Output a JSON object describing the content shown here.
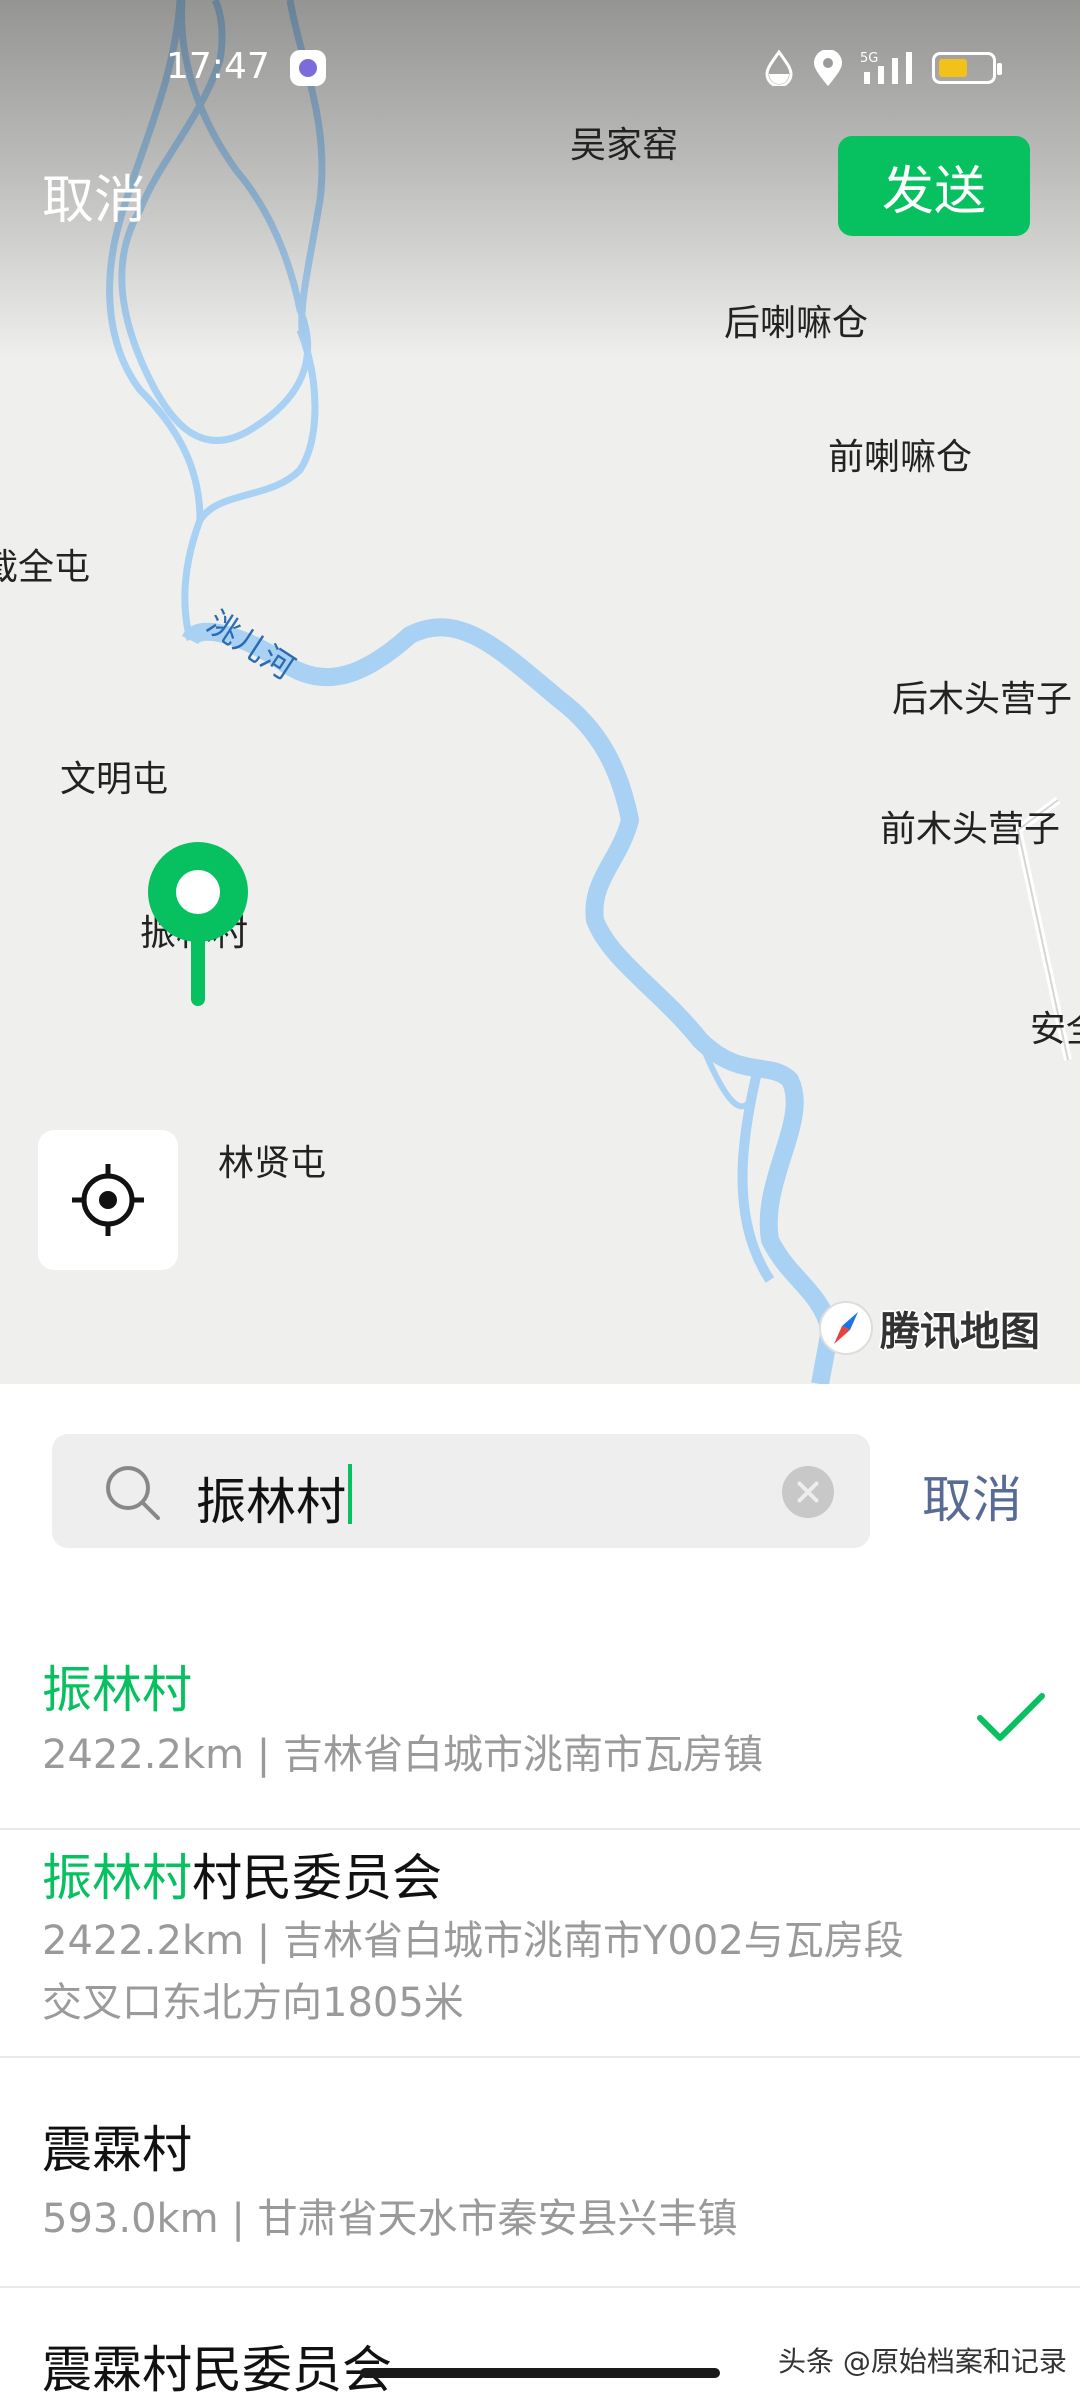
{
  "status_bar": {
    "time": "17:47",
    "network": "5G"
  },
  "top_bar": {
    "cancel_label": "取消",
    "send_label": "发送"
  },
  "map": {
    "places": [
      "吴家窑",
      "后喇嘛仓",
      "前喇嘛仓",
      "截全屯",
      "后木头营子",
      "文明屯",
      "前木头营子",
      "振林村",
      "安全",
      "林贤屯"
    ],
    "river_label": "洮儿河",
    "provider": "腾讯地图",
    "colors": {
      "water": "#a8d1f4",
      "road": "#ffffff",
      "land": "#efefed"
    }
  },
  "search": {
    "query": "振林村",
    "cancel_label": "取消"
  },
  "results": [
    {
      "title_highlight": "振林村",
      "title_rest": "",
      "subtitle": "2422.2km | 吉林省白城市洮南市瓦房镇",
      "selected": true
    },
    {
      "title_highlight": "振林村",
      "title_rest": "村民委员会",
      "subtitle": "2422.2km | 吉林省白城市洮南市Y002与瓦房段交叉口东北方向1805米",
      "selected": false
    },
    {
      "title_highlight": "",
      "title_rest": "震霖村",
      "subtitle": "593.0km | 甘肃省天水市秦安县兴丰镇",
      "selected": false
    },
    {
      "title_highlight": "",
      "title_rest": "震霖村民委员会",
      "subtitle": "",
      "selected": false
    }
  ],
  "watermark": "头条 @原始档案和记录",
  "colors": {
    "accent": "#07c160",
    "link": "#576b95",
    "muted": "#9a9a9a"
  }
}
